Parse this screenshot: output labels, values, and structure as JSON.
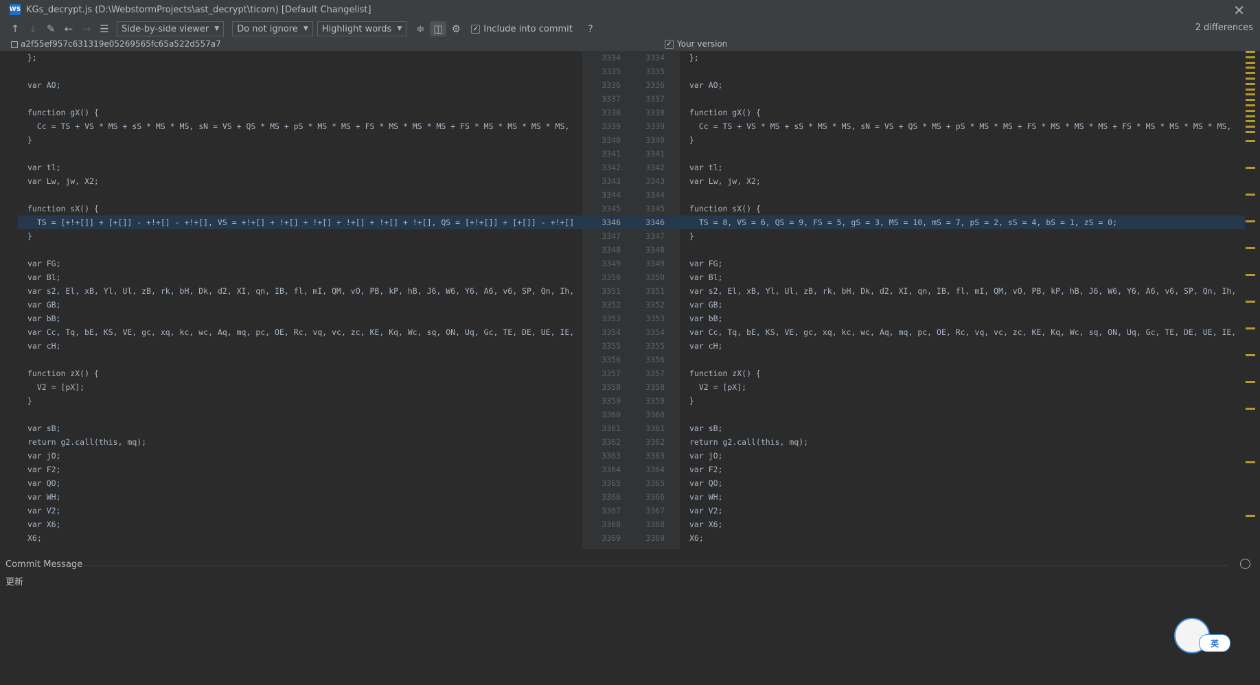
{
  "window": {
    "title": "KGs_decrypt.js (D:\\WebstormProjects\\ast_decrypt\\ticom) [Default Changelist]"
  },
  "toolbar": {
    "viewer_label": "Side-by-side viewer",
    "ignore_label": "Do not ignore",
    "highlight_label": "Highlight words",
    "include_commit_label": "Include into commit",
    "help_label": "?",
    "differences": "2 differences"
  },
  "header": {
    "left_revision": "a2f55ef957c631319e05269565fc65a522d557a7",
    "right_label": "Your version"
  },
  "lines": {
    "numbers": [
      "3334",
      "3335",
      "3336",
      "3337",
      "3338",
      "3339",
      "3340",
      "3341",
      "3342",
      "3343",
      "3344",
      "3345",
      "3346",
      "3347",
      "3348",
      "3349",
      "3350",
      "3351",
      "3352",
      "3353",
      "3354",
      "3355",
      "3356",
      "3357",
      "3358",
      "3359",
      "3360",
      "3361",
      "3362",
      "3363",
      "3364",
      "3365",
      "3366",
      "3367",
      "3368",
      "3369"
    ],
    "changed_line": "3346"
  },
  "left_code": [
    "};",
    "",
    "var AO;",
    "",
    "function gX() {",
    "  Cc = TS + VS * MS + sS * MS * MS, sN = VS + QS * MS + pS * MS * MS + FS * MS * MS * MS + FS * MS * MS * MS * MS,",
    "}",
    "",
    "var tl;",
    "var Lw, jw, X2;",
    "",
    "function sX() {",
    "  TS = [+!+[]] + [+[]] - +!+[] - +!+[], VS = +!+[] + !+[] + !+[] + !+[] + !+[] + !+[], QS = [+!+[]] + [+[]] - +!+[]",
    "}",
    "",
    "var FG;",
    "var Bl;",
    "var s2, El, xB, Yl, Ul, zB, rk, bH, Dk, d2, XI, qn, IB, fl, mI, QM, vO, PB, kP, hB, J6, W6, Y6, A6, v6, SP, Qn, Ih,",
    "var GB;",
    "var bB;",
    "var Cc, Tq, bE, KS, VE, gc, xq, kc, wc, Aq, mq, pc, OE, Rc, vq, vc, zc, KE, Kq, Wc, sq, ON, Uq, Gc, TE, DE, UE, IE,",
    "var cH;",
    "",
    "function zX() {",
    "  V2 = [pX];",
    "}",
    "",
    "var sB;",
    "return g2.call(this, mq);",
    "var jO;",
    "var F2;",
    "var QO;",
    "var WH;",
    "var V2;",
    "var X6;",
    "X6;"
  ],
  "right_code": [
    "};",
    "",
    "var AO;",
    "",
    "function gX() {",
    "  Cc = TS + VS * MS + sS * MS * MS, sN = VS + QS * MS + pS * MS * MS + FS * MS * MS * MS + FS * MS * MS * MS * MS, ",
    "}",
    "",
    "var tl;",
    "var Lw, jw, X2;",
    "",
    "function sX() {",
    "  TS = 8, VS = 6, QS = 9, FS = 5, gS = 3, MS = 10, mS = 7, pS = 2, sS = 4, bS = 1, zS = 0;",
    "}",
    "",
    "var FG;",
    "var Bl;",
    "var s2, El, xB, Yl, Ul, zB, rk, bH, Dk, d2, XI, qn, IB, fl, mI, QM, vO, PB, kP, hB, J6, W6, Y6, A6, v6, SP, Qn, Ih,",
    "var GB;",
    "var bB;",
    "var Cc, Tq, bE, KS, VE, gc, xq, kc, wc, Aq, mq, pc, OE, Rc, vq, vc, zc, KE, Kq, Wc, sq, ON, Uq, Gc, TE, DE, UE, IE,",
    "var cH;",
    "",
    "function zX() {",
    "  V2 = [pX];",
    "}",
    "",
    "var sB;",
    "return g2.call(this, mq);",
    "var jO;",
    "var F2;",
    "var QO;",
    "var WH;",
    "var V2;",
    "var X6;",
    "X6;"
  ],
  "commit": {
    "header": "Commit Message",
    "text": "更新",
    "badge": "英"
  },
  "colors": {
    "change_bg": "#26384b",
    "word_highlight": "#2f4f78",
    "scroll_marks": "#b39a31"
  }
}
